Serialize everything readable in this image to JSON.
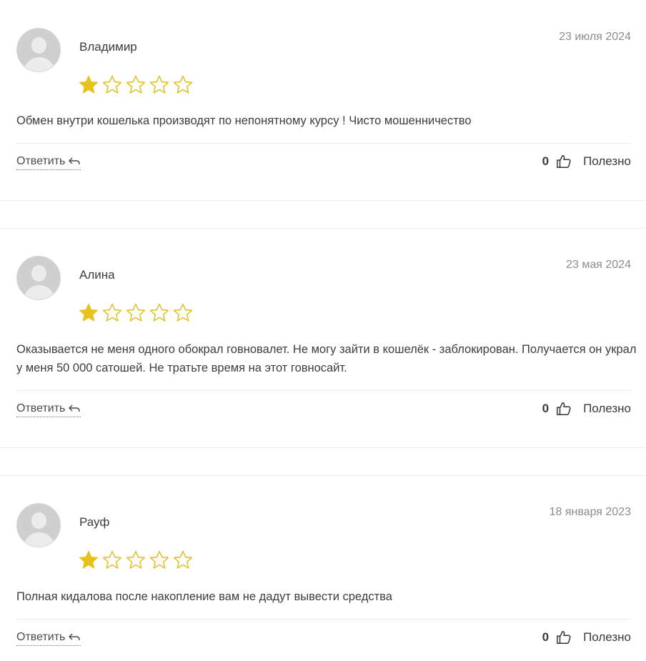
{
  "colors": {
    "star_filled": "#e8c21c",
    "star_outline": "#e3bd22",
    "avatar_bg": "#cfcfcf",
    "date_text": "#8c8c8c"
  },
  "reviews": [
    {
      "name": "Владимир",
      "date": "23 июля 2024",
      "rating": 1,
      "text": "Обмен внутри кошелька производят по непонятному курсу ! Чисто мошенничество",
      "reply_label": "Ответить",
      "likes": "0",
      "useful_label": "Полезно"
    },
    {
      "name": "Алина",
      "date": "23 мая 2024",
      "rating": 1,
      "text": "Оказывается не меня одного обокрал говновалет. Не могу зайти в кошелёк - заблокирован. Получается он украл у меня 50 000 сатошей. Не тратьте время на этот говносайт.",
      "reply_label": "Ответить",
      "likes": "0",
      "useful_label": "Полезно"
    },
    {
      "name": "Рауф",
      "date": "18 января 2023",
      "rating": 1,
      "text": "Полная кидалова после накопление вам не дадут вывести средства",
      "reply_label": "Ответить",
      "likes": "0",
      "useful_label": "Полезно"
    }
  ]
}
